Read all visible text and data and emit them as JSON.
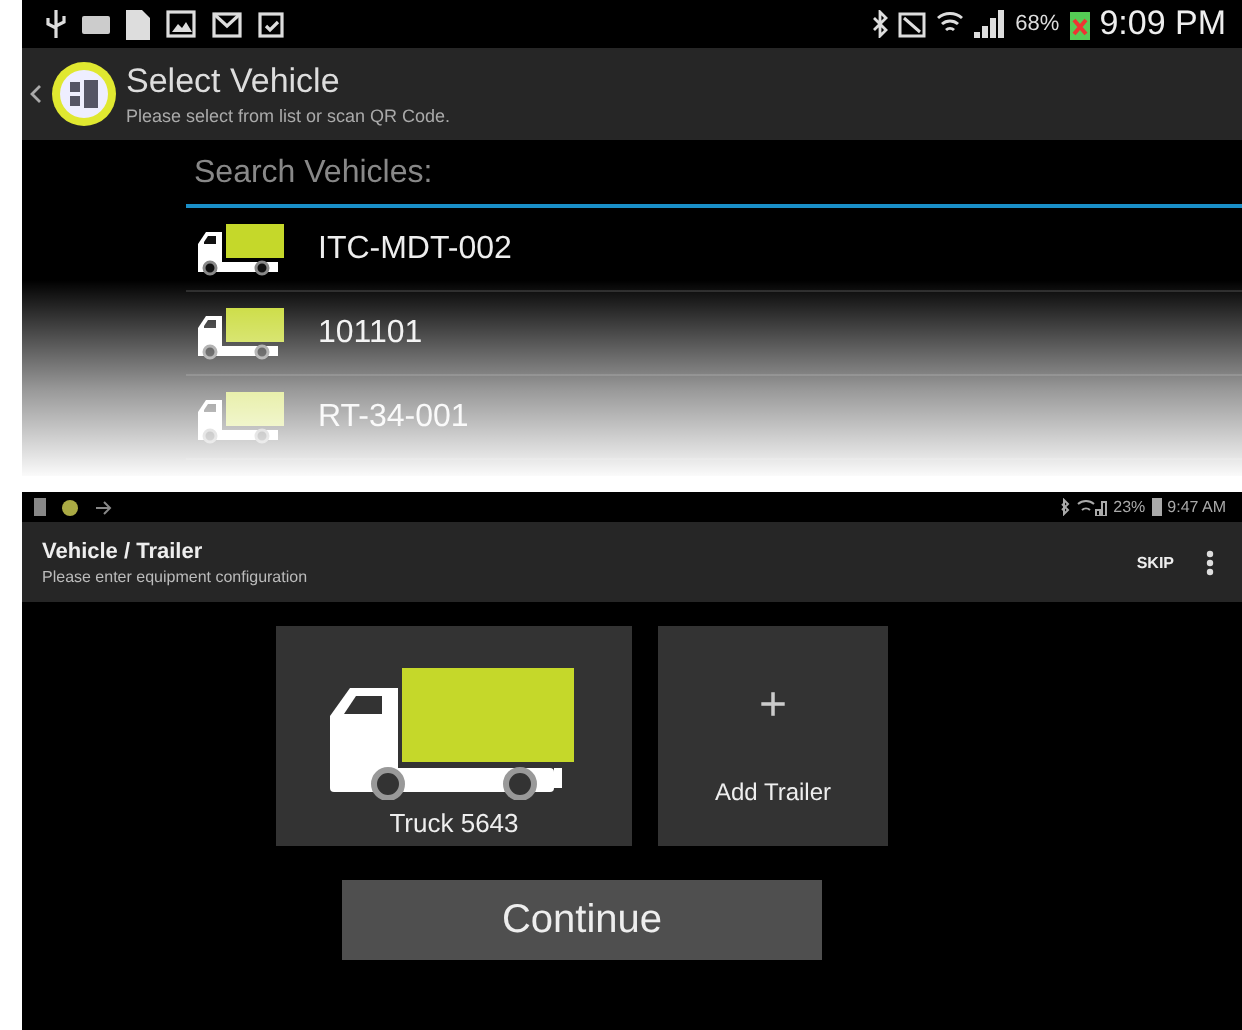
{
  "select_vehicle_screen": {
    "status_bar": {
      "battery": "68%",
      "time": "9:09 PM"
    },
    "header": {
      "title": "Select Vehicle",
      "subtitle": "Please select from list or scan QR Code."
    },
    "search": {
      "placeholder": "Search Vehicles:"
    },
    "vehicles": [
      {
        "name": "ITC-MDT-002"
      },
      {
        "name": "101101"
      },
      {
        "name": "RT-34-001"
      }
    ]
  },
  "equipment_screen": {
    "status_bar": {
      "battery": "23%",
      "time": "9:47 AM"
    },
    "header": {
      "title": "Vehicle / Trailer",
      "subtitle": "Please enter equipment configuration",
      "action": "SKIP"
    },
    "tiles": [
      {
        "kind": "vehicle",
        "label": "Truck 5643"
      },
      {
        "kind": "add",
        "symbol": "+",
        "label": "Add Trailer"
      }
    ],
    "continue_button": "Continue"
  }
}
